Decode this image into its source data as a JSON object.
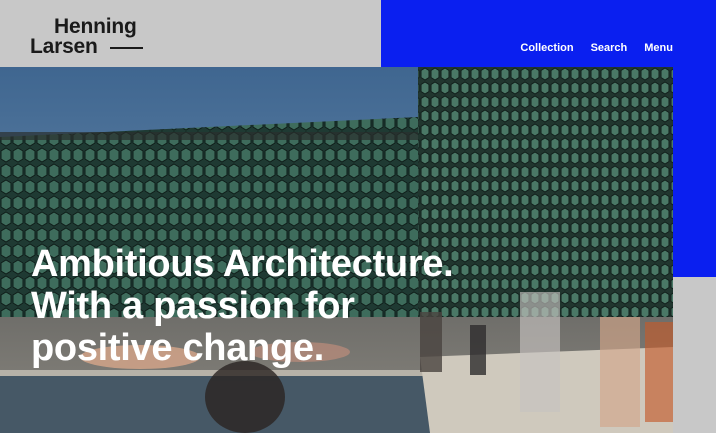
{
  "logo": {
    "line1": "Henning",
    "line2": "Larsen"
  },
  "nav": {
    "items": [
      "Collection",
      "Search",
      "Menu"
    ]
  },
  "hero": {
    "headline_lines": [
      "Ambitious Architecture.",
      "With a passion for",
      "positive change."
    ]
  },
  "colors": {
    "accent_blue": "#0a1ff0",
    "panel_grey": "#c8c8c8",
    "logo_text": "#1a1a1a",
    "headline_text": "#ffffff"
  }
}
